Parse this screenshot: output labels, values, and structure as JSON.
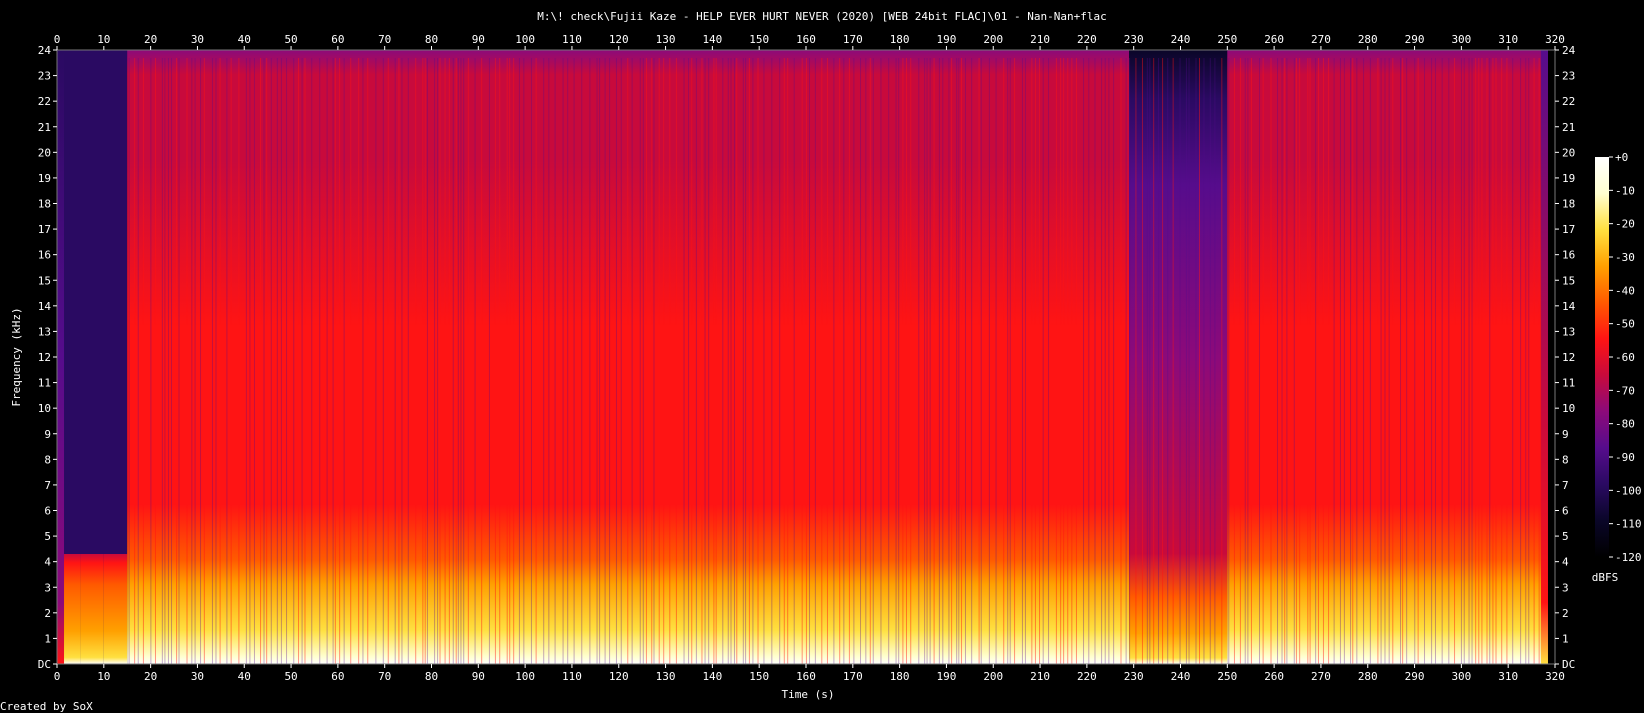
{
  "chart_data": {
    "type": "heatmap",
    "title": "M:\\! check\\Fujii Kaze - HELP EVER HURT NEVER (2020) [WEB 24bit FLAC]\\01 - Nan-Nan+flac",
    "xlabel": "Time (s)",
    "ylabel": "Frequency (kHz)",
    "xlim": [
      0,
      320
    ],
    "ylim": [
      0,
      24
    ],
    "x_ticks": [
      "0",
      "10",
      "20",
      "30",
      "40",
      "50",
      "60",
      "70",
      "80",
      "90",
      "100",
      "110",
      "120",
      "130",
      "140",
      "150",
      "160",
      "170",
      "180",
      "190",
      "200",
      "210",
      "220",
      "230",
      "240",
      "250",
      "260",
      "270",
      "280",
      "290",
      "300",
      "310",
      "320"
    ],
    "y_ticks": [
      "DC",
      "1",
      "2",
      "3",
      "4",
      "5",
      "6",
      "7",
      "8",
      "9",
      "10",
      "11",
      "12",
      "13",
      "14",
      "15",
      "16",
      "17",
      "18",
      "19",
      "20",
      "21",
      "22",
      "23",
      "24"
    ],
    "duration_s": 318.5,
    "colorbar": {
      "unit": "dBFS",
      "range": [
        -120,
        0
      ],
      "ticks": [
        "+0",
        "-10",
        "-20",
        "-30",
        "-40",
        "-50",
        "-60",
        "-70",
        "-80",
        "-90",
        "-100",
        "-110",
        "-120"
      ]
    },
    "segments": [
      {
        "start": 0,
        "end": 1.5,
        "cutoff_khz": 24,
        "level": "quiet"
      },
      {
        "start": 1.5,
        "end": 5,
        "cutoff_khz": 4.3,
        "level": "intro"
      },
      {
        "start": 5,
        "end": 10,
        "cutoff_khz": 4.3,
        "level": "intro"
      },
      {
        "start": 10,
        "end": 15,
        "cutoff_khz": 4.3,
        "level": "intro"
      },
      {
        "start": 15,
        "end": 229,
        "cutoff_khz": 24,
        "level": "full"
      },
      {
        "start": 229,
        "end": 250,
        "cutoff_khz": 24,
        "level": "breakdown"
      },
      {
        "start": 250,
        "end": 317,
        "cutoff_khz": 24,
        "level": "full"
      },
      {
        "start": 317,
        "end": 318.5,
        "cutoff_khz": 24,
        "level": "fade"
      }
    ],
    "colors": {
      "background": "#000000",
      "text": "#ffffff",
      "palette": [
        "#000000",
        "#0a0628",
        "#2a0a62",
        "#560c8c",
        "#8c0a7a",
        "#c80a3c",
        "#ff1414",
        "#ff5a00",
        "#ffa000",
        "#ffe040",
        "#ffffd0",
        "#ffffff"
      ]
    }
  },
  "footer": {
    "credit": "Created by SoX"
  }
}
